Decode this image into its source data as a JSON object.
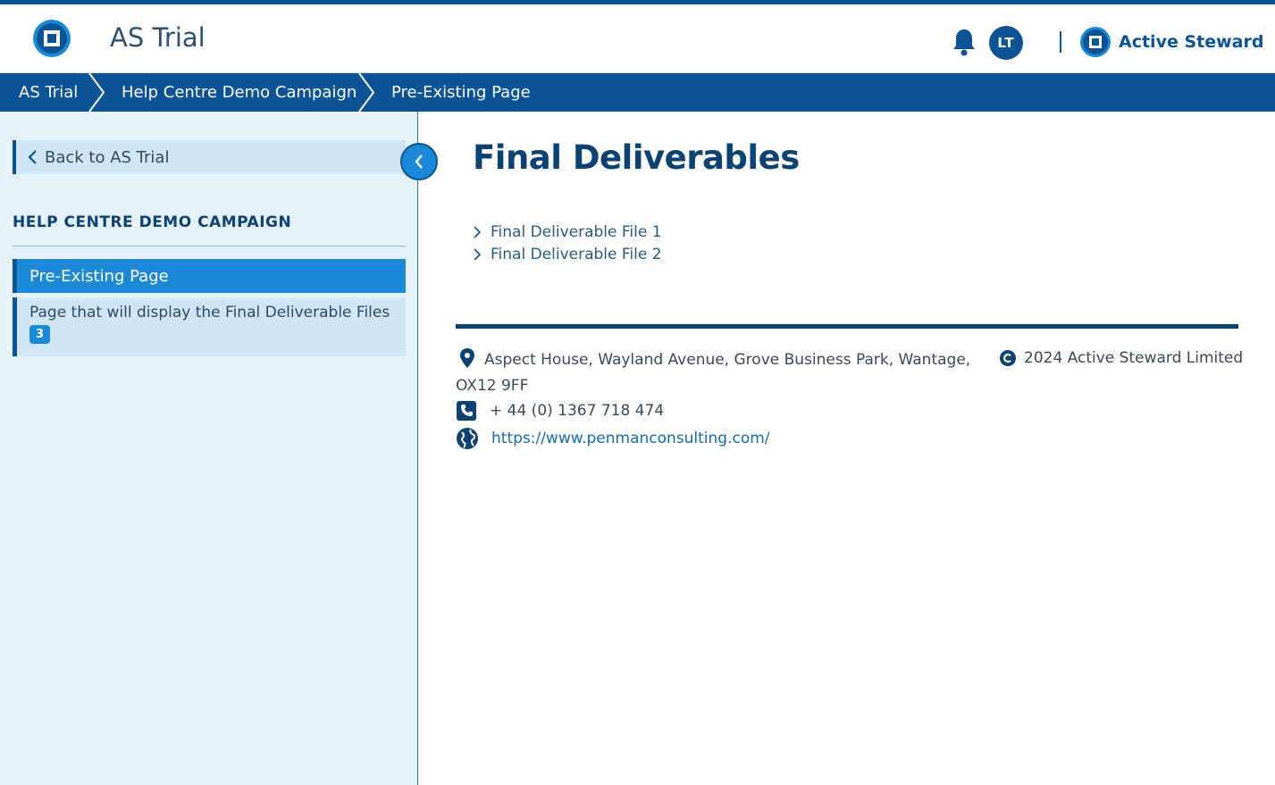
{
  "header": {
    "app_title": "AS Trial",
    "avatar_initials": "LT",
    "brand_name": "Active Steward"
  },
  "breadcrumb": [
    {
      "label": "AS Trial"
    },
    {
      "label": "Help Centre Demo Campaign"
    },
    {
      "label": "Pre-Existing Page"
    }
  ],
  "sidebar": {
    "back_label": "Back to AS Trial",
    "section_title": "HELP CENTRE DEMO CAMPAIGN",
    "items": [
      {
        "label": "Pre-Existing Page",
        "active": true
      },
      {
        "label": "Page that will display the Final Deliverable Files",
        "badge": "3"
      }
    ]
  },
  "main": {
    "title": "Final Deliverables",
    "files": [
      {
        "label": "Final Deliverable File 1"
      },
      {
        "label": "Final Deliverable File 2"
      }
    ]
  },
  "footer": {
    "address": "Aspect House, Wayland Avenue, Grove Business Park, Wantage, OX12 9FF",
    "copyright": "2024 Active Steward Limited",
    "phone": "+ 44 (0) 1367 718 474",
    "website": "https://www.penmanconsulting.com/"
  },
  "colors": {
    "primary": "#0b5394",
    "accent": "#1a8ad6",
    "sidebar_bg": "#e6f2f9"
  }
}
